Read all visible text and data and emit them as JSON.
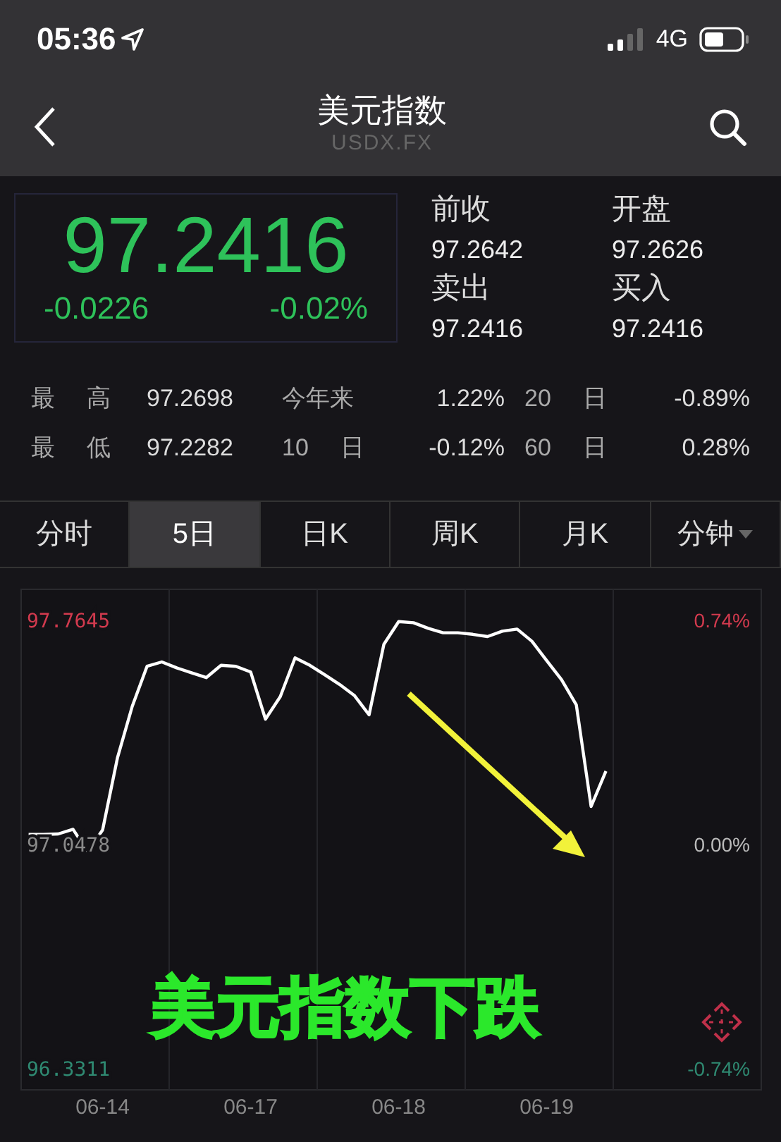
{
  "status_bar": {
    "time": "05:36",
    "network": "4G"
  },
  "nav": {
    "title": "美元指数",
    "subtitle": "USDX.FX"
  },
  "quote": {
    "price": "97.2416",
    "change": "-0.0226",
    "change_percent": "-0.02%",
    "fields": [
      {
        "label": "前收",
        "value": "97.2642"
      },
      {
        "label": "开盘",
        "value": "97.2626"
      },
      {
        "label": "卖出",
        "value": "97.2416"
      },
      {
        "label": "买入",
        "value": "97.2416"
      }
    ]
  },
  "stats": [
    [
      {
        "label": "最 高",
        "value": "97.2698"
      },
      {
        "label": "今年来",
        "value": "1.22%"
      },
      {
        "label": "20 日",
        "value": "-0.89%"
      }
    ],
    [
      {
        "label": "最 低",
        "value": "97.2282"
      },
      {
        "label": "10 日",
        "value": "-0.12%"
      },
      {
        "label": "60 日",
        "value": "0.28%"
      }
    ]
  ],
  "tabs": [
    {
      "label": "分时",
      "selected": false,
      "dropdown": false
    },
    {
      "label": "5日",
      "selected": true,
      "dropdown": false
    },
    {
      "label": "日K",
      "selected": false,
      "dropdown": false
    },
    {
      "label": "周K",
      "selected": false,
      "dropdown": false
    },
    {
      "label": "月K",
      "selected": false,
      "dropdown": false
    },
    {
      "label": "分钟",
      "selected": false,
      "dropdown": true
    }
  ],
  "chart": {
    "right_labels": [
      "0.74%",
      "0.00%",
      "-0.74%"
    ],
    "chart_data": {
      "type": "line",
      "categories": [
        null,
        null,
        null,
        null,
        null,
        "06-14",
        null,
        null,
        null,
        null,
        null,
        null,
        null,
        null,
        null,
        "06-17",
        null,
        null,
        null,
        null,
        null,
        null,
        null,
        null,
        null,
        "06-18",
        null,
        null,
        null,
        null,
        null,
        null,
        null,
        null,
        null,
        "06-19",
        null,
        null,
        null,
        null,
        null,
        null,
        null,
        null,
        null,
        null,
        null,
        null,
        null,
        null
      ],
      "ylim": [
        96.259,
        97.859
      ],
      "yticks": [
        {
          "value": 97.7645,
          "label": "97.7645"
        },
        {
          "value": 97.0478,
          "label": "97.0478"
        },
        {
          "value": 96.3311,
          "label": "96.3311"
        }
      ],
      "series": [
        {
          "color": "#ffffff",
          "values": [
            97.075,
            97.075,
            97.077,
            97.092,
            97.02,
            97.09,
            97.32,
            97.485,
            97.613,
            97.627,
            97.608,
            97.592,
            97.577,
            97.616,
            97.613,
            97.595,
            97.444,
            97.516,
            97.64,
            97.616,
            97.586,
            97.555,
            97.52,
            97.458,
            97.683,
            97.756,
            97.752,
            97.734,
            97.72,
            97.72,
            97.715,
            97.708,
            97.725,
            97.732,
            97.693,
            97.631,
            97.57,
            97.49,
            97.165,
            97.278,
            null,
            null,
            null,
            null,
            null,
            null,
            null,
            null,
            null,
            null
          ]
        }
      ],
      "annotations": [
        {
          "text": "美元指数下跌"
        }
      ]
    }
  }
}
